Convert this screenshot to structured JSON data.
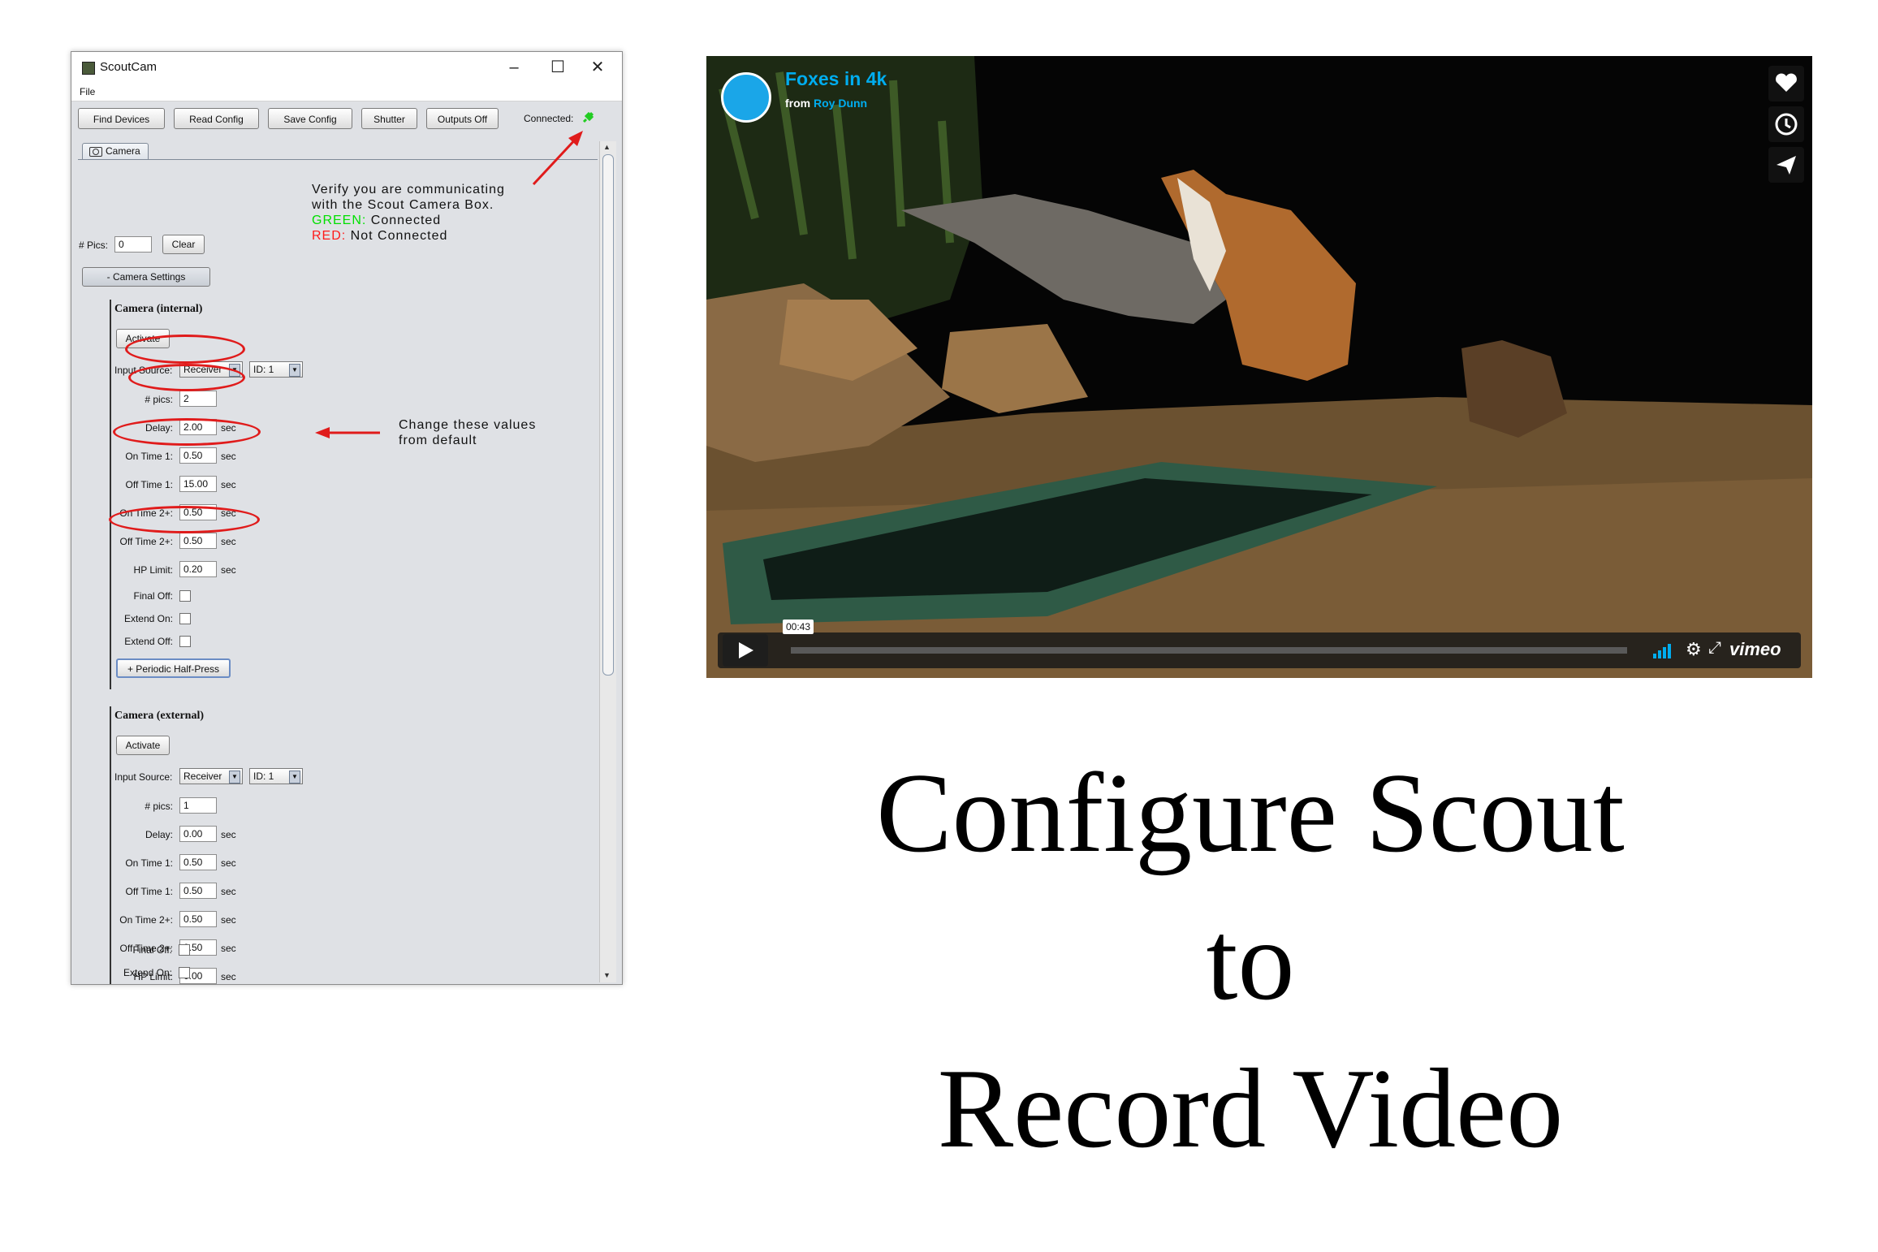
{
  "window": {
    "title": "ScoutCam",
    "menu_file": "File",
    "toolbar": {
      "find_devices": "Find Devices",
      "read_config": "Read Config",
      "save_config": "Save Config",
      "shutter": "Shutter",
      "outputs_off": "Outputs Off",
      "connected_label": "Connected:"
    },
    "tab_camera": "Camera",
    "pics_label": "# Pics:",
    "pics_value": "0",
    "clear": "Clear",
    "camera_settings": "- Camera Settings",
    "internal": {
      "title": "Camera (internal)",
      "activate": "Activate",
      "input_source_label": "Input Source:",
      "input_source": "Receiver",
      "id": "ID: 1",
      "pics_label": "# pics:",
      "pics": "2",
      "delay_label": "Delay:",
      "delay": "2.00",
      "on1_label": "On Time 1:",
      "on1": "0.50",
      "off1_label": "Off Time 1:",
      "off1": "15.00",
      "on2_label": "On Time 2+:",
      "on2": "0.50",
      "off2_label": "Off Time 2+:",
      "off2": "0.50",
      "hp_label": "HP Limit:",
      "hp": "0.20",
      "final_off": "Final Off:",
      "extend_on": "Extend On:",
      "extend_off": "Extend Off:",
      "periodic": "+ Periodic Half-Press"
    },
    "external": {
      "title": "Camera (external)",
      "activate": "Activate",
      "input_source_label": "Input Source:",
      "input_source": "Receiver",
      "id": "ID: 1",
      "pics_label": "# pics:",
      "pics": "1",
      "delay_label": "Delay:",
      "delay": "0.00",
      "on1_label": "On Time 1:",
      "on1": "0.50",
      "off1_label": "Off Time 1:",
      "off1": "0.50",
      "on2_label": "On Time 2+:",
      "on2": "0.50",
      "off2_label": "Off Time 2+:",
      "off2": "0.50",
      "hp_label": "HP Limit:",
      "hp": "0.00",
      "final_off": "Final Off:",
      "extend_on": "Extend On:"
    },
    "unit": "sec"
  },
  "annotations": {
    "verify_1": "Verify you are communicating",
    "verify_2": "with the Scout Camera Box.",
    "green_word": "GREEN:",
    "green_rest": " Connected",
    "red_word": "RED:",
    "red_rest": " Not Connected",
    "change_1": "Change these values",
    "change_2": "from default"
  },
  "video": {
    "title": "Foxes in 4k",
    "from_prefix": "from ",
    "author": "Roy Dunn",
    "timestamp": "00:43",
    "brand": "vimeo"
  },
  "caption": {
    "line1": "Configure Scout",
    "line2": "to",
    "line3": "Record Video"
  },
  "colors": {
    "annotation_red": "#e01b1b",
    "connected_green": "#22cc22",
    "vimeo_blue": "#00adef"
  }
}
